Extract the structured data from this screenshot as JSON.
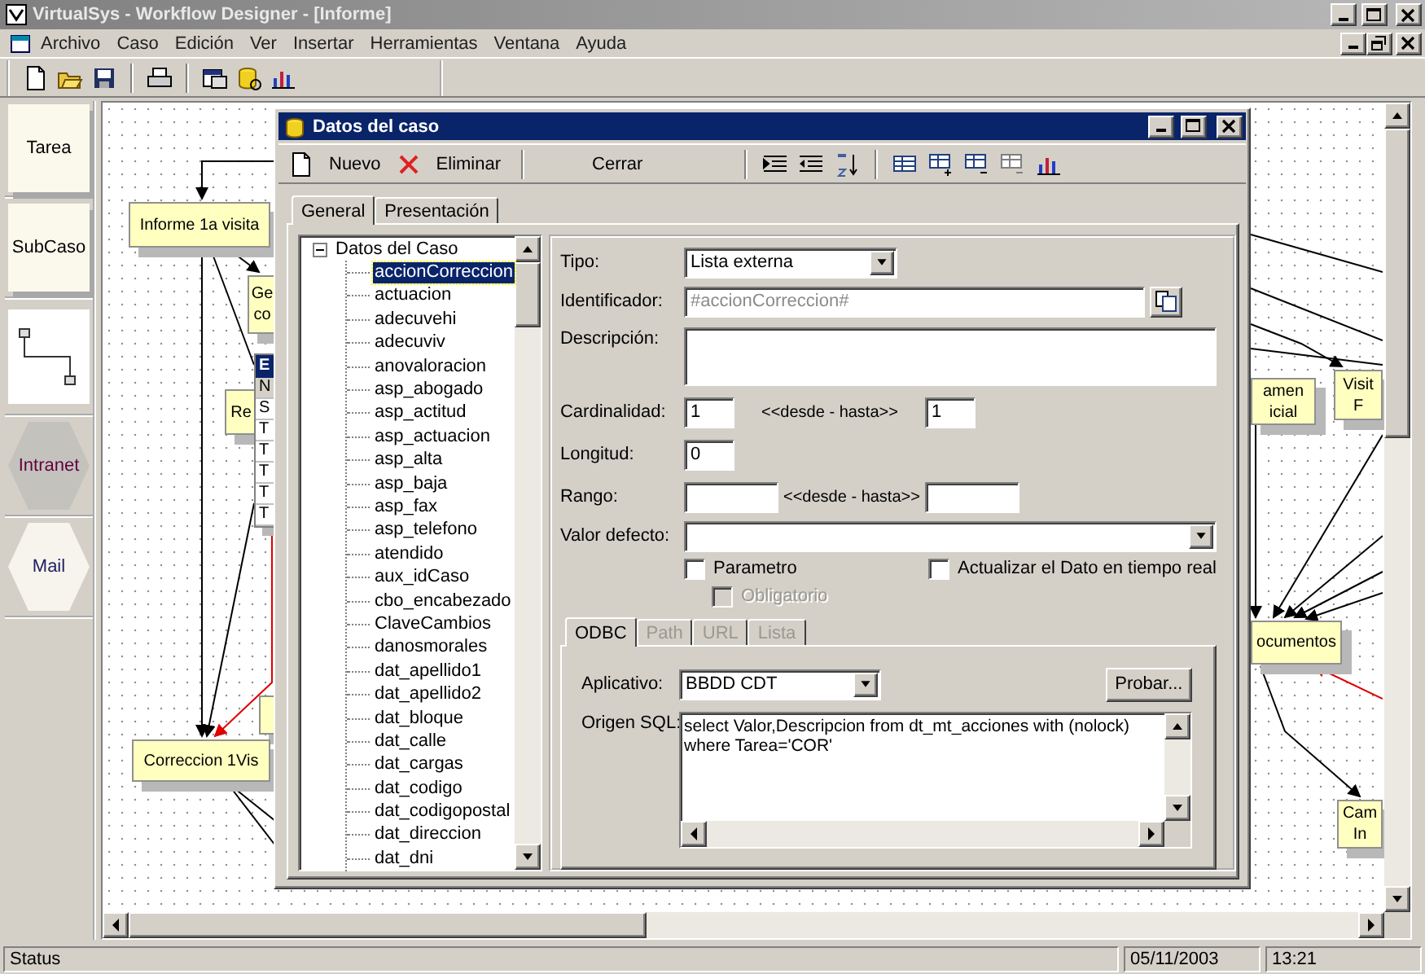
{
  "window": {
    "title": "VirtualSys - Workflow Designer - [Informe]"
  },
  "menu": [
    "Archivo",
    "Caso",
    "Edición",
    "Ver",
    "Insertar",
    "Herramientas",
    "Ventana",
    "Ayuda"
  ],
  "palette": [
    {
      "kind": "task",
      "label": "Tarea"
    },
    {
      "kind": "task",
      "label": "SubCaso"
    },
    {
      "kind": "connector"
    },
    {
      "kind": "hexagon-dark",
      "label": "Intranet"
    },
    {
      "kind": "hexagon",
      "label": "Mail"
    }
  ],
  "diagram": {
    "nodes": [
      {
        "kind": "task",
        "lines": [
          "Informe 1a visita"
        ]
      },
      {
        "kind": "task",
        "lines": [
          "Ge",
          "co"
        ]
      },
      {
        "kind": "task",
        "lines": [
          "Re"
        ]
      },
      {
        "kind": "table",
        "title": "E",
        "rows": [
          "N",
          "S",
          "T",
          "T",
          "T",
          "T",
          "T"
        ]
      },
      {
        "kind": "task"
      },
      {
        "kind": "task",
        "lines": [
          "Correccion 1Vis"
        ]
      },
      {
        "kind": "task",
        "lines": [
          "amen",
          "icial"
        ]
      },
      {
        "kind": "task",
        "lines": [
          "Visit",
          "F"
        ]
      },
      {
        "kind": "task",
        "lines": [
          "ocumentos"
        ]
      },
      {
        "kind": "task",
        "lines": [
          "Cam",
          "In"
        ]
      }
    ]
  },
  "dialog": {
    "title": "Datos del caso",
    "toolbar": [
      {
        "kind": "new",
        "label": "Nuevo"
      },
      {
        "kind": "delete",
        "label": "Eliminar"
      },
      {
        "kind": "close",
        "label": "Cerrar"
      }
    ],
    "tabs": [
      {
        "label": "General",
        "selected": true
      },
      {
        "label": "Presentación",
        "selected": false
      }
    ],
    "tree": {
      "label": "Datos del Caso",
      "expanded": true,
      "children": [
        {
          "label": "accionCorreccion",
          "selected": true
        },
        {
          "label": "actuacion",
          "selected": false
        },
        {
          "label": "adecuvehi",
          "selected": false
        },
        {
          "label": "adecuviv",
          "selected": false
        },
        {
          "label": "anovaloracion",
          "selected": false
        },
        {
          "label": "asp_abogado",
          "selected": false
        },
        {
          "label": "asp_actitud",
          "selected": false
        },
        {
          "label": "asp_actuacion",
          "selected": false
        },
        {
          "label": "asp_alta",
          "selected": false
        },
        {
          "label": "asp_baja",
          "selected": false
        },
        {
          "label": "asp_fax",
          "selected": false
        },
        {
          "label": "asp_telefono",
          "selected": false
        },
        {
          "label": "atendido",
          "selected": false
        },
        {
          "label": "aux_idCaso",
          "selected": false
        },
        {
          "label": "cbo_encabezado",
          "selected": false
        },
        {
          "label": "ClaveCambios",
          "selected": false
        },
        {
          "label": "danosmorales",
          "selected": false
        },
        {
          "label": "dat_apellido1",
          "selected": false
        },
        {
          "label": "dat_apellido2",
          "selected": false
        },
        {
          "label": "dat_bloque",
          "selected": false
        },
        {
          "label": "dat_calle",
          "selected": false
        },
        {
          "label": "dat_cargas",
          "selected": false
        },
        {
          "label": "dat_codigo",
          "selected": false
        },
        {
          "label": "dat_codigopostal",
          "selected": false
        },
        {
          "label": "dat_direccion",
          "selected": false
        },
        {
          "label": "dat_dni",
          "selected": false
        }
      ]
    },
    "form": {
      "tipo": {
        "label": "Tipo:",
        "value": "Lista externa"
      },
      "identificador": {
        "label": "Identificador:",
        "value": "#accionCorreccion#",
        "disabled": true
      },
      "descripcion": {
        "label": "Descripción:"
      },
      "cardinalidad": {
        "label": "Cardinalidad:",
        "from": "1",
        "range_label": "<<desde - hasta>>",
        "to": "1"
      },
      "longitud": {
        "label": "Longitud:",
        "value": "0"
      },
      "rango": {
        "label": "Rango:",
        "range_label": "<<desde - hasta>>"
      },
      "valor_defecto": {
        "label": "Valor defecto:"
      },
      "checkboxes": [
        {
          "label": "Parametro",
          "checked": false,
          "disabled": false
        },
        {
          "label": "Actualizar el Dato en tiempo real",
          "checked": false,
          "disabled": false
        },
        {
          "label": "Obligatorio",
          "checked": false,
          "disabled": true
        }
      ],
      "source_tabs": [
        {
          "label": "ODBC",
          "selected": true,
          "disabled": false
        },
        {
          "label": "Path",
          "selected": false,
          "disabled": true
        },
        {
          "label": "URL",
          "selected": false,
          "disabled": true
        },
        {
          "label": "Lista",
          "selected": false,
          "disabled": true
        }
      ],
      "aplicativo": {
        "label": "Aplicativo:",
        "value": "BBDD CDT"
      },
      "test_button": "Probar...",
      "sql": {
        "label": "Origen SQL:",
        "value": "select Valor,Descripcion from dt_mt_acciones with (nolock)\nwhere Tarea='COR'"
      }
    }
  },
  "status_bar": [
    "Status",
    "05/11/2003",
    "13:21"
  ]
}
